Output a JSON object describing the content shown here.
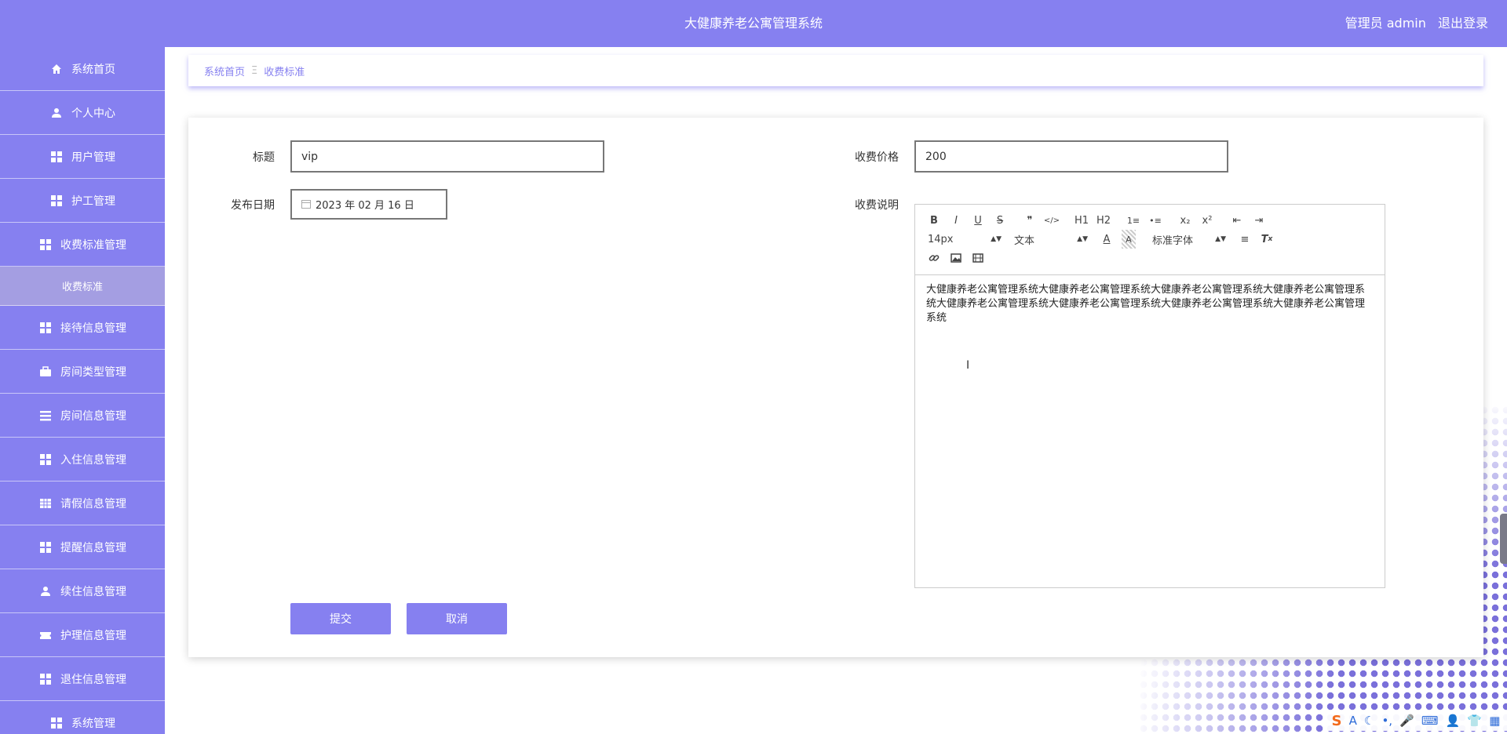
{
  "header": {
    "title": "大健康养老公寓管理系统",
    "user_label": "管理员 admin",
    "logout": "退出登录"
  },
  "sidebar": {
    "items": [
      {
        "label": "系统首页",
        "icon": "home-icon"
      },
      {
        "label": "个人中心",
        "icon": "user-icon"
      },
      {
        "label": "用户管理",
        "icon": "grid-icon"
      },
      {
        "label": "护工管理",
        "icon": "grid-icon"
      },
      {
        "label": "收费标准管理",
        "icon": "grid-icon"
      },
      {
        "label": "收费标准",
        "icon": ""
      },
      {
        "label": "接待信息管理",
        "icon": "grid-icon"
      },
      {
        "label": "房间类型管理",
        "icon": "briefcase-icon"
      },
      {
        "label": "房间信息管理",
        "icon": "list-icon"
      },
      {
        "label": "入住信息管理",
        "icon": "grid-icon"
      },
      {
        "label": "请假信息管理",
        "icon": "table-icon"
      },
      {
        "label": "提醒信息管理",
        "icon": "grid-icon"
      },
      {
        "label": "续住信息管理",
        "icon": "user-icon"
      },
      {
        "label": "护理信息管理",
        "icon": "ticket-icon"
      },
      {
        "label": "退住信息管理",
        "icon": "grid-icon"
      },
      {
        "label": "系统管理",
        "icon": "grid-icon"
      }
    ]
  },
  "breadcrumb": {
    "home": "系统首页",
    "separator": "Ξ",
    "current": "收费标准"
  },
  "form": {
    "title_label": "标题",
    "title_value": "vip",
    "price_label": "收费价格",
    "price_value": "200",
    "date_label": "发布日期",
    "date_value": "2023 年 02 月 16 日",
    "desc_label": "收费说明",
    "desc_content": "大健康养老公寓管理系统大健康养老公寓管理系统大健康养老公寓管理系统大健康养老公寓管理系统大健康养老公寓管理系统大健康养老公寓管理系统大健康养老公寓管理系统大健康养老公寓管理系统",
    "submit": "提交",
    "cancel": "取消"
  },
  "editor": {
    "font_size": "14px",
    "block_format": "文本",
    "font_family": "标准字体",
    "toolbar_row1": [
      "B",
      "I",
      "U",
      "S",
      "❞",
      "</>",
      "H1",
      "H2",
      "1≡",
      "•≡",
      "x₂",
      "x²",
      "⇤",
      "⇥"
    ]
  },
  "tray": {
    "items": [
      "S",
      "A",
      "☾",
      "•,",
      "🎤",
      "⌨",
      "👤",
      "👕",
      "▦"
    ]
  },
  "colors": {
    "accent": "#8680f0",
    "submenu": "#a49ee2"
  }
}
